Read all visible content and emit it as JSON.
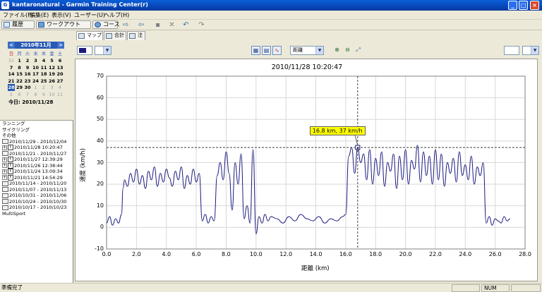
{
  "window": {
    "title": "kantaronatural - Garmin Training Center(r)",
    "controls": {
      "minimize": "_",
      "maximize": "□",
      "close": "×"
    }
  },
  "menubar": [
    "ファイル(F)",
    "編集(E)",
    "表示(V)",
    "ユーザー(U)",
    "ヘルプ(H)"
  ],
  "toolbar": {
    "history": "履歴",
    "workouts": "ワークアウト",
    "courses": "コース"
  },
  "calendar": {
    "month_label": "2010年11月",
    "prev": "<",
    "next": ">",
    "weekdays": [
      "日",
      "月",
      "火",
      "水",
      "木",
      "金",
      "土"
    ],
    "weeks": [
      [
        {
          "d": "31",
          "dim": true
        },
        {
          "d": "1"
        },
        {
          "d": "2"
        },
        {
          "d": "3"
        },
        {
          "d": "4"
        },
        {
          "d": "5"
        },
        {
          "d": "6"
        }
      ],
      [
        {
          "d": "7"
        },
        {
          "d": "8"
        },
        {
          "d": "9"
        },
        {
          "d": "10"
        },
        {
          "d": "11"
        },
        {
          "d": "12"
        },
        {
          "d": "13"
        }
      ],
      [
        {
          "d": "14"
        },
        {
          "d": "15"
        },
        {
          "d": "16"
        },
        {
          "d": "17"
        },
        {
          "d": "18"
        },
        {
          "d": "19"
        },
        {
          "d": "20"
        }
      ],
      [
        {
          "d": "21"
        },
        {
          "d": "22"
        },
        {
          "d": "23"
        },
        {
          "d": "24"
        },
        {
          "d": "25"
        },
        {
          "d": "26"
        },
        {
          "d": "27"
        }
      ],
      [
        {
          "d": "28",
          "sel": true
        },
        {
          "d": "29"
        },
        {
          "d": "30"
        },
        {
          "d": "1",
          "dim": true
        },
        {
          "d": "2",
          "dim": true
        },
        {
          "d": "3",
          "dim": true
        },
        {
          "d": "4",
          "dim": true
        }
      ],
      [
        {
          "d": "5",
          "dim": true
        },
        {
          "d": "6",
          "dim": true
        },
        {
          "d": "7",
          "dim": true
        },
        {
          "d": "8",
          "dim": true
        },
        {
          "d": "9",
          "dim": true
        },
        {
          "d": "10",
          "dim": true
        },
        {
          "d": "11",
          "dim": true
        }
      ]
    ],
    "today_label": "今日: 2010/11/28"
  },
  "tree": {
    "categories": [
      "ランニング",
      "サイクリング",
      "その他"
    ],
    "items": [
      {
        "type": "cal",
        "label": "2010/11/29 - 2010/12/04"
      },
      {
        "type": "act",
        "label": "2010/11/28 10:20:47",
        "expander": "+",
        "selected": true
      },
      {
        "type": "cal",
        "label": "2010/11/21 - 2010/11/27"
      },
      {
        "type": "act",
        "label": "2010/11/27 12:39:29",
        "expander": "+"
      },
      {
        "type": "act",
        "label": "2010/11/26 12:38:44",
        "expander": "+"
      },
      {
        "type": "act",
        "label": "2010/11/24 13:09:34",
        "expander": "+"
      },
      {
        "type": "act",
        "label": "2010/11/21 14:54:29",
        "expander": "+"
      },
      {
        "type": "cal",
        "label": "2010/11/14 - 2010/11/20"
      },
      {
        "type": "cal",
        "label": "2010/11/07 - 2010/11/13"
      },
      {
        "type": "cal",
        "label": "2010/10/31 - 2010/11/06"
      },
      {
        "type": "cal",
        "label": "2010/10/24 - 2010/10/30"
      },
      {
        "type": "cal",
        "label": "2010/10/17 - 2010/10/23"
      }
    ],
    "multisport": "MultiSport"
  },
  "tabs": [
    "マップ",
    "合計",
    "注"
  ],
  "graph_toolbar": {
    "xaxis_select": "距離"
  },
  "chart_data": {
    "type": "line",
    "title": "2010/11/28 10:20:47",
    "xlabel": "距離 (km)",
    "ylabel": "速度 (km/h)",
    "xlim": [
      0.0,
      28.0
    ],
    "ylim": [
      -10,
      70
    ],
    "xticks": [
      "0.0",
      "2.0",
      "4.0",
      "6.0",
      "8.0",
      "10.0",
      "12.0",
      "14.0",
      "16.0",
      "18.0",
      "20.0",
      "22.0",
      "24.0",
      "26.0",
      "28.0"
    ],
    "yticks": [
      "70",
      "60",
      "50",
      "40",
      "30",
      "20",
      "10",
      "0",
      "-10"
    ],
    "grid": true,
    "series_color": "#1a1a80",
    "cursor": {
      "x": 16.8,
      "y": 37,
      "label": "16.8 km, 37 km/h"
    },
    "series": [
      {
        "x": [
          0.0,
          0.2,
          0.4,
          0.6,
          0.8,
          1.0,
          1.1,
          1.2,
          1.4,
          1.6,
          1.8,
          2.0,
          2.2,
          2.4,
          2.6,
          2.8,
          3.0,
          3.2,
          3.4,
          3.6,
          3.8,
          4.0,
          4.2,
          4.4,
          4.6,
          4.8,
          5.0,
          5.2,
          5.4,
          5.6,
          5.8,
          6.0,
          6.2,
          6.4,
          6.6,
          6.8,
          7.0,
          7.2,
          7.4,
          7.6,
          7.8,
          8.0,
          8.2,
          8.4,
          8.6,
          8.8,
          9.0,
          9.2,
          9.4,
          9.6,
          9.8,
          10.0,
          10.2,
          10.4,
          10.6,
          10.8,
          11.0,
          11.4,
          11.8,
          12.2,
          12.6,
          13.0,
          13.4,
          13.8,
          14.2,
          14.6,
          15.0,
          15.4,
          15.8,
          16.0,
          16.2,
          16.4,
          16.6,
          16.8,
          17.0,
          17.2,
          17.4,
          17.6,
          17.8,
          18.0,
          18.2,
          18.4,
          18.6,
          18.8,
          19.0,
          19.2,
          19.4,
          19.6,
          19.8,
          20.0,
          20.2,
          20.4,
          20.6,
          20.8,
          21.0,
          21.2,
          21.4,
          21.6,
          21.8,
          22.0,
          22.2,
          22.4,
          22.6,
          22.8,
          23.0,
          23.2,
          23.4,
          23.6,
          23.8,
          24.0,
          24.2,
          24.4,
          24.6,
          24.8,
          25.0,
          25.2,
          25.4,
          25.6,
          25.8,
          26.0,
          26.2,
          26.4,
          26.6,
          26.8,
          27.0
        ],
        "y": [
          2,
          5,
          1,
          4,
          2,
          6,
          18,
          22,
          19,
          25,
          21,
          27,
          20,
          24,
          18,
          26,
          22,
          28,
          19,
          25,
          21,
          27,
          23,
          19,
          26,
          22,
          28,
          18,
          24,
          20,
          27,
          21,
          25,
          3,
          6,
          2,
          5,
          3,
          24,
          30,
          22,
          35,
          25,
          8,
          30,
          20,
          34,
          4,
          10,
          2,
          36,
          -3,
          5,
          2,
          6,
          3,
          5,
          4,
          2,
          5,
          3,
          6,
          4,
          3,
          5,
          2,
          4,
          3,
          5,
          6,
          33,
          37,
          25,
          37,
          30,
          34,
          22,
          36,
          20,
          32,
          24,
          35,
          19,
          30,
          26,
          34,
          18,
          33,
          22,
          36,
          20,
          31,
          27,
          38,
          21,
          35,
          24,
          33,
          20,
          36,
          22,
          34,
          19,
          30,
          25,
          32,
          21,
          35,
          24,
          29,
          22,
          33,
          20,
          28,
          24,
          30,
          2,
          5,
          1,
          4,
          3,
          2,
          5,
          3,
          4
        ]
      }
    ]
  },
  "status": {
    "text": "準備完了",
    "num": "NUM"
  }
}
